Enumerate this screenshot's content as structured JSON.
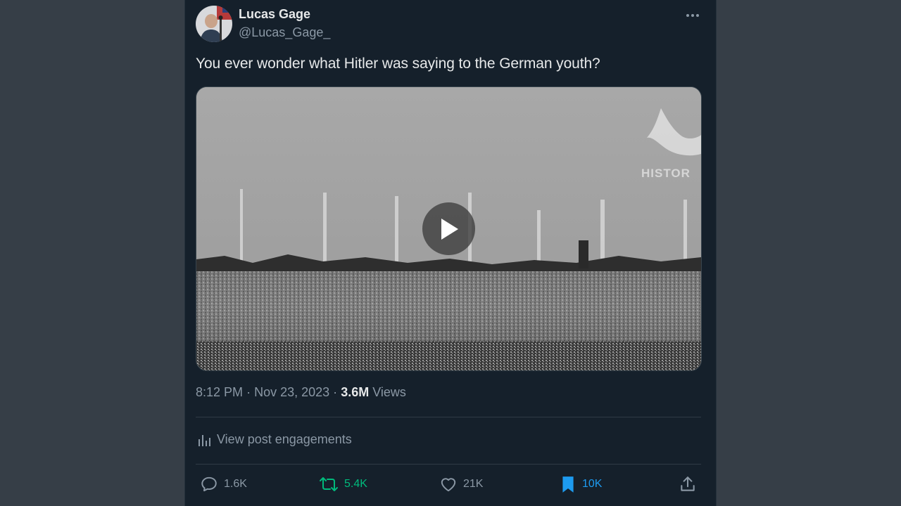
{
  "author": {
    "name": "Lucas Gage",
    "handle": "@Lucas_Gage_"
  },
  "post": {
    "text": "You ever wonder what Hitler was saying to the German youth?",
    "video_watermark": "HISTOR",
    "time": "8:12 PM",
    "date": "Nov 23, 2023",
    "separator": "·",
    "views_count": "3.6M",
    "views_label": "Views"
  },
  "engagements_link": "View post engagements",
  "actions": {
    "reply": {
      "count": "1.6K",
      "color": "#8b98a5"
    },
    "repost": {
      "count": "5.4K",
      "color": "#00ba7c"
    },
    "like": {
      "count": "21K",
      "color": "#8b98a5"
    },
    "bookmark": {
      "count": "10K",
      "color": "#1d9bf0"
    }
  },
  "icons": [
    "more-icon",
    "play-icon",
    "analytics-icon",
    "reply-icon",
    "repost-icon",
    "like-icon",
    "bookmark-icon",
    "share-icon"
  ],
  "colors": {
    "background": "#363e47",
    "panel": "#15202b",
    "text_primary": "#e7e9ea",
    "text_secondary": "#8b98a5",
    "accent_blue": "#1d9bf0",
    "accent_green": "#00ba7c"
  }
}
